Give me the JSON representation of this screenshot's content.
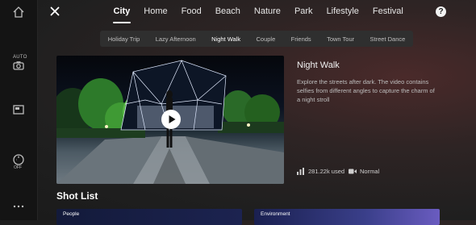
{
  "window": {
    "close_icon": "close-icon",
    "help_label": "?"
  },
  "top_tabs": [
    {
      "label": "City",
      "active": true
    },
    {
      "label": "Home"
    },
    {
      "label": "Food"
    },
    {
      "label": "Beach"
    },
    {
      "label": "Nature"
    },
    {
      "label": "Park"
    },
    {
      "label": "Lifestyle"
    },
    {
      "label": "Festival"
    }
  ],
  "sub_tabs": [
    {
      "label": "Holiday Trip"
    },
    {
      "label": "Lazy Afternoon"
    },
    {
      "label": "Night Walk",
      "active": true
    },
    {
      "label": "Couple"
    },
    {
      "label": "Friends"
    },
    {
      "label": "Town Tour"
    },
    {
      "label": "Street Dance"
    }
  ],
  "side_rail": {
    "auto_label": "AUTO",
    "off_label": "OFF",
    "icons": [
      "home-icon",
      "camera-auto-icon",
      "aspect-ratio-icon",
      "timer-off-icon",
      "more-icon"
    ]
  },
  "detail": {
    "title": "Night Walk",
    "description": "Explore the streets after dark. The video contains selfies from different angles to capture the charm of a night stroll",
    "used": "281.22k used",
    "speed": "Normal"
  },
  "shot_list": {
    "title": "Shot List",
    "cards": [
      {
        "label": "People"
      },
      {
        "label": "Environment"
      }
    ]
  },
  "colors": {
    "accent": "#ffffff",
    "background": "#1f1f1f",
    "sub_tab_bg": "#2f2f2f"
  }
}
